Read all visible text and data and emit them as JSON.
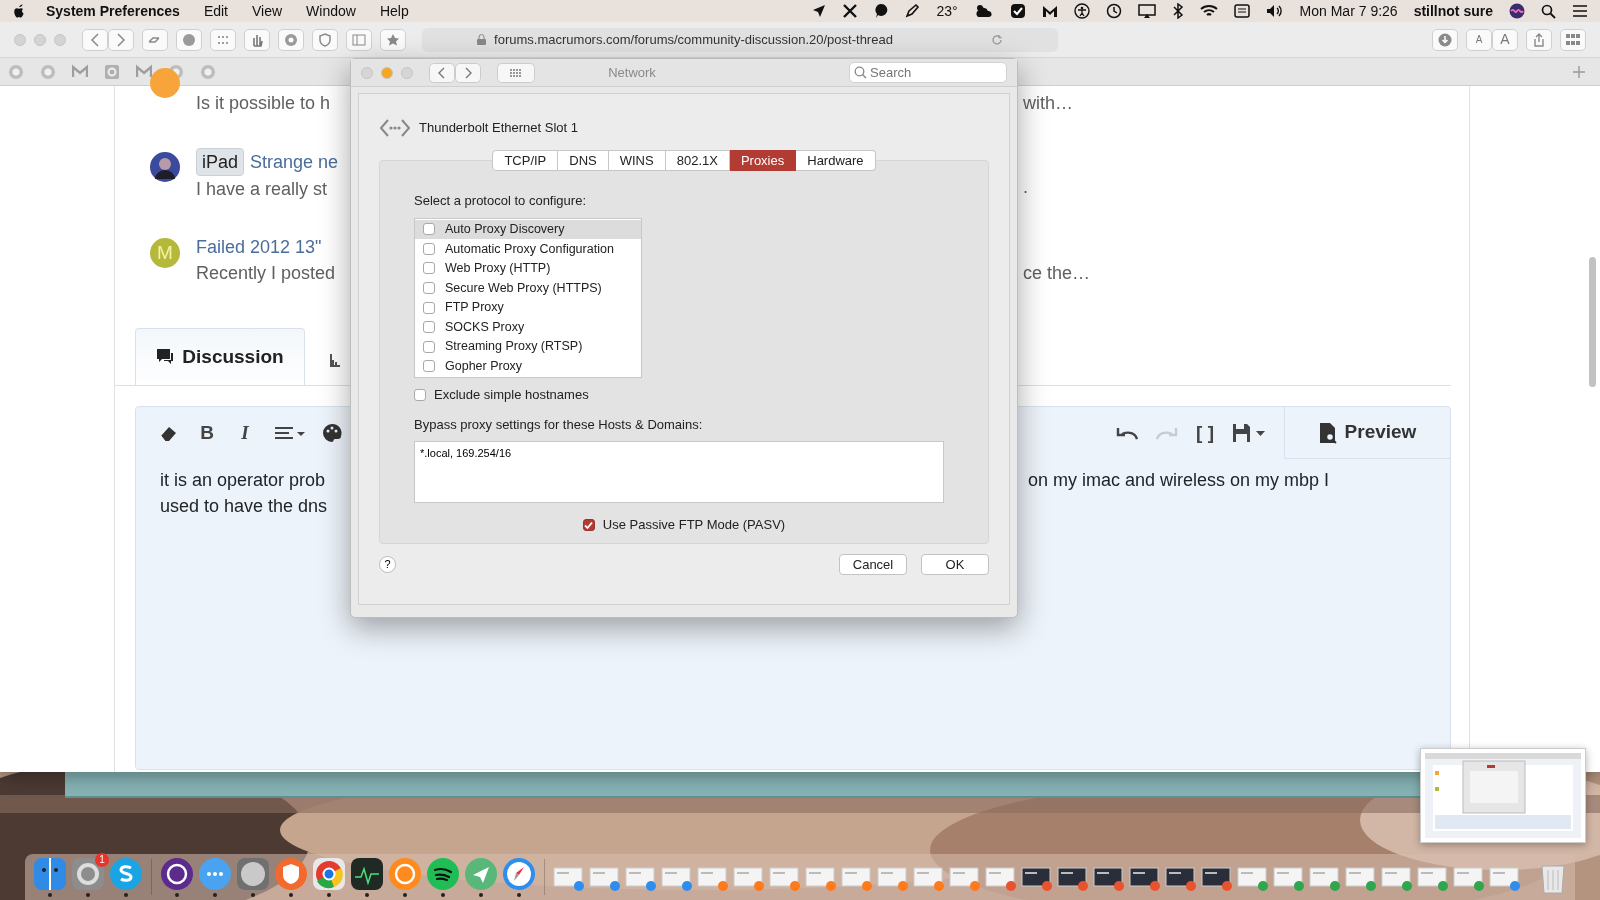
{
  "menu_bar": {
    "app_name": "System Preferences",
    "menus": [
      "Edit",
      "View",
      "Window",
      "Help"
    ],
    "temperature": "23°",
    "clock": "Mon Mar 7  9:26",
    "user": "stillnot sure"
  },
  "browser": {
    "address": "forums.macrumors.com/forums/community-discussion.20/post-thread",
    "text_size_buttons": [
      "A",
      "A"
    ],
    "threads": [
      {
        "avatar": {
          "kind": "dot",
          "color": "#f7a43b"
        },
        "snippet": "Is it possible to h",
        "snippet_end": "with…"
      },
      {
        "prefix": "iPad",
        "title": "Strange ne",
        "snippet": "I have a really st",
        "snippet_end": "."
      },
      {
        "avatar": {
          "kind": "letter",
          "letter": "M",
          "color": "#b5b83a"
        },
        "title": "Failed 2012 13\"",
        "snippet": "Recently I posted",
        "snippet_end": "ce the…"
      }
    ],
    "tabs": [
      {
        "label": "Discussion",
        "selected": true
      }
    ],
    "editor": {
      "format_buttons": [
        "B",
        "I"
      ],
      "bracket_button": "[ ]",
      "preview": "Preview",
      "text_lines": [
        "it is an operator prob",
        "used to have the dns"
      ],
      "text_end": "on my imac and wireless on my mbp I"
    }
  },
  "network": {
    "title": "Network",
    "search_placeholder": "Search",
    "interface": "Thunderbolt Ethernet Slot 1",
    "tabs": [
      {
        "label": "TCP/IP",
        "selected": false
      },
      {
        "label": "DNS",
        "selected": false
      },
      {
        "label": "WINS",
        "selected": false
      },
      {
        "label": "802.1X",
        "selected": false
      },
      {
        "label": "Proxies",
        "selected": true
      },
      {
        "label": "Hardware",
        "selected": false
      }
    ],
    "prompt": "Select a protocol to configure:",
    "protocols": [
      {
        "label": "Auto Proxy Discovery",
        "checked": false,
        "selected": true
      },
      {
        "label": "Automatic Proxy Configuration",
        "checked": false,
        "selected": false
      },
      {
        "label": "Web Proxy (HTTP)",
        "checked": false,
        "selected": false
      },
      {
        "label": "Secure Web Proxy (HTTPS)",
        "checked": false,
        "selected": false
      },
      {
        "label": "FTP Proxy",
        "checked": false,
        "selected": false
      },
      {
        "label": "SOCKS Proxy",
        "checked": false,
        "selected": false
      },
      {
        "label": "Streaming Proxy (RTSP)",
        "checked": false,
        "selected": false
      },
      {
        "label": "Gopher Proxy",
        "checked": false,
        "selected": false
      }
    ],
    "exclude": {
      "label": "Exclude simple hostnames",
      "checked": false
    },
    "bypass_label": "Bypass proxy settings for these Hosts & Domains:",
    "bypass_value": "*.local, 169.254/16",
    "pasv": {
      "label": "Use Passive FTP Mode (PASV)",
      "checked": true
    },
    "help": "?",
    "buttons": [
      "Cancel",
      "OK"
    ]
  },
  "dock": {
    "badge": "1"
  }
}
